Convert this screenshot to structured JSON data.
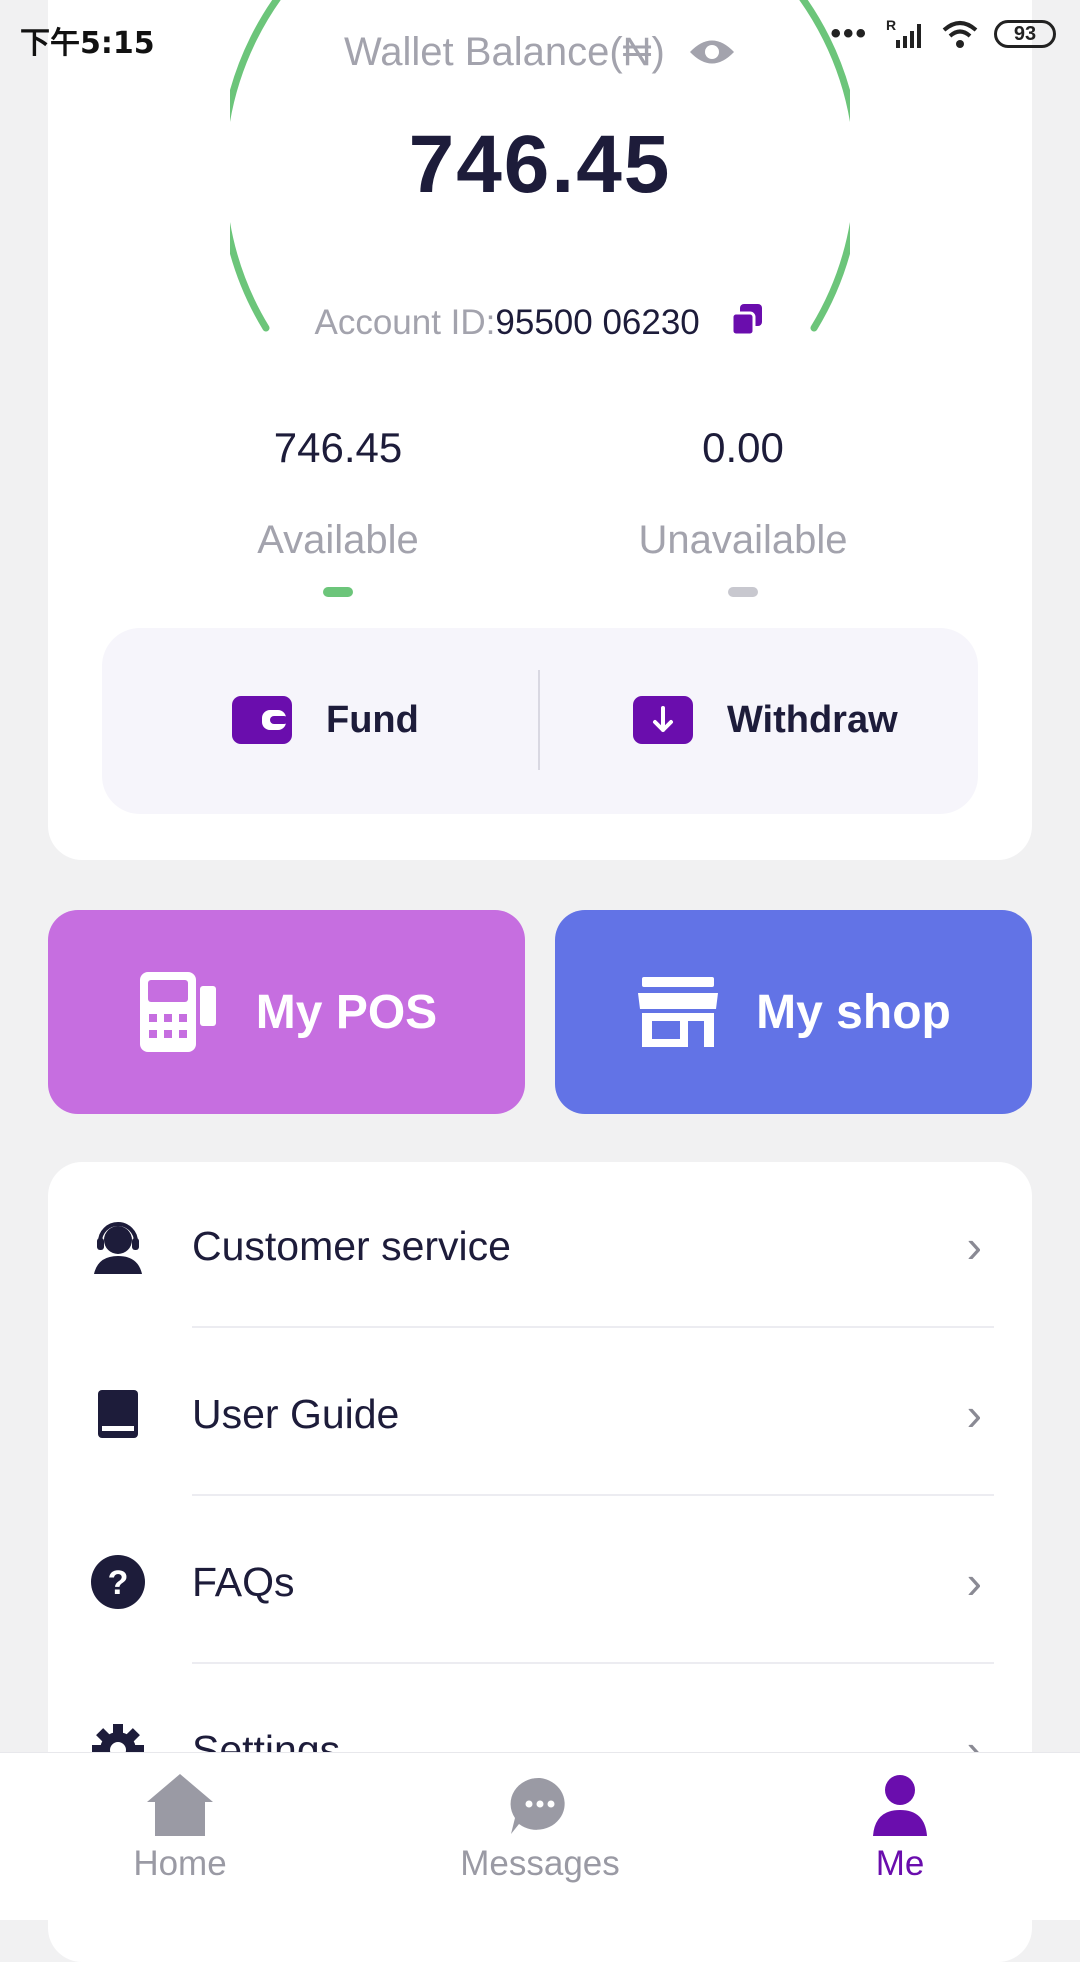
{
  "status_bar": {
    "time": "下午5:15",
    "battery": "93"
  },
  "wallet": {
    "title": "Wallet Balance(₦)",
    "balance": "746.45",
    "account_id_label": "Account ID:",
    "account_id": "95500 06230",
    "available_value": "746.45",
    "available_label": "Available",
    "unavailable_value": "0.00",
    "unavailable_label": "Unavailable",
    "fund_label": "Fund",
    "withdraw_label": "Withdraw"
  },
  "tiles": {
    "pos_label": "My POS",
    "shop_label": "My shop"
  },
  "menu": [
    {
      "label": "Customer service",
      "icon": "headset-icon"
    },
    {
      "label": "User Guide",
      "icon": "book-icon"
    },
    {
      "label": "FAQs",
      "icon": "question-icon"
    },
    {
      "label": "Settings",
      "icon": "gear-icon"
    }
  ],
  "nav": [
    {
      "label": "Home",
      "icon": "home-icon"
    },
    {
      "label": "Messages",
      "icon": "chat-icon"
    },
    {
      "label": "Me",
      "icon": "person-icon",
      "active": true
    }
  ],
  "colors": {
    "accent": "#6a0dad",
    "arc": "#6cc57a",
    "pos_tile": "#c66ee0",
    "shop_tile": "#6273e6"
  }
}
